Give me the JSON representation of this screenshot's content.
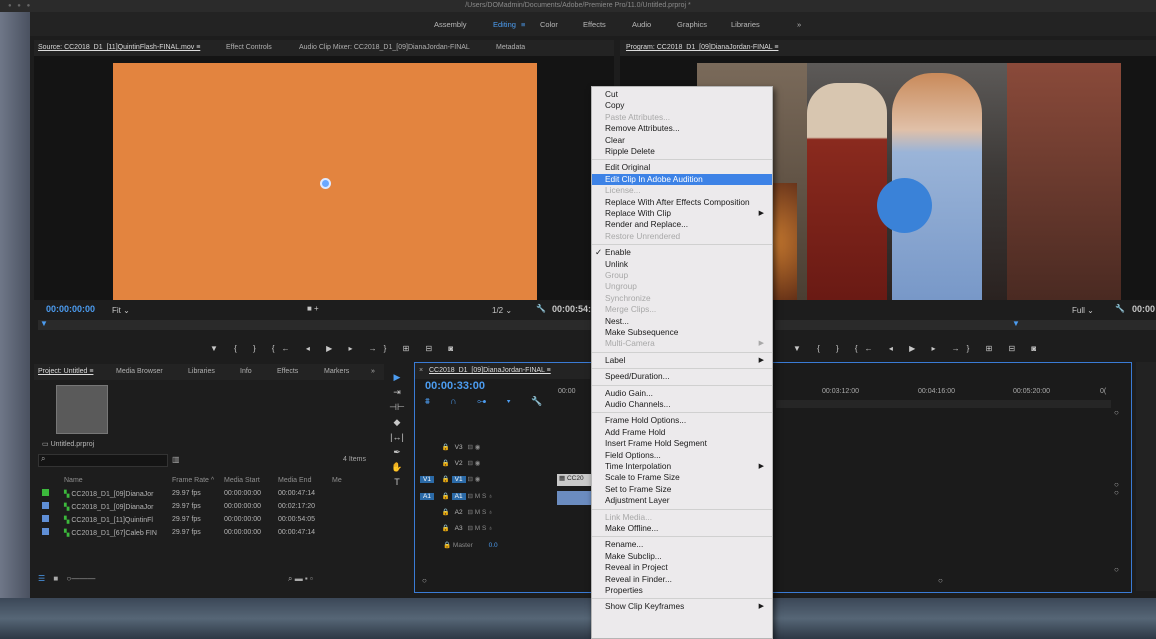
{
  "window": {
    "path": "/Users/DOMadmin/Documents/Adobe/Premiere Pro/11.0/Untitled.prproj *"
  },
  "workspaces": {
    "items": [
      "Assembly",
      "Editing",
      "Color",
      "Effects",
      "Audio",
      "Graphics",
      "Libraries"
    ],
    "active": "Editing",
    "menu_icon": "≡",
    "overflow": "»"
  },
  "source_panel": {
    "tabs": [
      "Source: CC2018_D1_[11]QuintinFlash-FINAL.mov  ≡",
      "Effect Controls",
      "Audio Clip Mixer: CC2018_D1_[09]DianaJordan-FINAL",
      "Metadata"
    ],
    "timecode": "00:00:00:00",
    "fit": "Fit",
    "resolution": "1/2",
    "duration": "00:00:54:",
    "frame_color": "#e3843f"
  },
  "program_panel": {
    "title": "Program: CC2018_D1_[09]DianaJordan-FINAL  ≡",
    "full": "Full",
    "timecode": "00:00"
  },
  "project_panel": {
    "tabs": [
      "Project: Untitled  ≡",
      "Media Browser",
      "Libraries",
      "Info",
      "Effects",
      "Markers",
      "»"
    ],
    "file": "Untitled.prproj",
    "item_count": "4 Items",
    "columns": [
      "Name",
      "Frame Rate ^",
      "Media Start",
      "Media End",
      "Me"
    ],
    "rows": [
      {
        "color": "#3cb93c",
        "name": "CC2018_D1_[09]DianaJor",
        "fps": "29.97 fps",
        "start": "00:00:00:00",
        "end": "00:00:47:14"
      },
      {
        "color": "#5f8fd6",
        "name": "CC2018_D1_[09]DianaJor",
        "fps": "29.97 fps",
        "start": "00:00:00:00",
        "end": "00:02:17:20"
      },
      {
        "color": "#5f8fd6",
        "name": "CC2018_D1_[11]QuintinFl",
        "fps": "29.97 fps",
        "start": "00:00:00:00",
        "end": "00:00:54:05"
      },
      {
        "color": "#5f8fd6",
        "name": "CC2018_D1_[67]Caleb FIN",
        "fps": "29.97 fps",
        "start": "00:00:00:00",
        "end": "00:00:47:14"
      }
    ]
  },
  "timeline": {
    "title": "CC2018_D1_[09]DianaJordan-FINAL  ≡",
    "timecode": "00:00:33:00",
    "ruler": [
      "00:00",
      "00:03:12:00",
      "00:04:16:00",
      "00:05:20:00",
      "0("
    ],
    "tracks": [
      {
        "target": "",
        "name": "V3"
      },
      {
        "target": "",
        "name": "V2"
      },
      {
        "target": "V1",
        "name": "V1"
      },
      {
        "target": "A1",
        "name": "A1"
      },
      {
        "target": "",
        "name": "A2"
      },
      {
        "target": "",
        "name": "A3"
      }
    ],
    "master": "Master",
    "master_level": "0.0",
    "clip_label": "CC20"
  },
  "context_menu": {
    "groups": [
      [
        {
          "label": "Cut"
        },
        {
          "label": "Copy"
        },
        {
          "label": "Paste Attributes...",
          "disabled": true
        },
        {
          "label": "Remove Attributes..."
        },
        {
          "label": "Clear"
        },
        {
          "label": "Ripple Delete"
        }
      ],
      [
        {
          "label": "Edit Original"
        },
        {
          "label": "Edit Clip In Adobe Audition",
          "highlighted": true
        },
        {
          "label": "License...",
          "disabled": true
        },
        {
          "label": "Replace With After Effects Composition"
        },
        {
          "label": "Replace With Clip",
          "submenu": true
        },
        {
          "label": "Render and Replace..."
        },
        {
          "label": "Restore Unrendered",
          "disabled": true
        }
      ],
      [
        {
          "label": "Enable",
          "checked": true
        },
        {
          "label": "Unlink"
        },
        {
          "label": "Group",
          "disabled": true
        },
        {
          "label": "Ungroup",
          "disabled": true
        },
        {
          "label": "Synchronize",
          "disabled": true
        },
        {
          "label": "Merge Clips...",
          "disabled": true
        },
        {
          "label": "Nest..."
        },
        {
          "label": "Make Subsequence"
        },
        {
          "label": "Multi-Camera",
          "disabled": true,
          "submenu": true
        }
      ],
      [
        {
          "label": "Label",
          "submenu": true
        }
      ],
      [
        {
          "label": "Speed/Duration..."
        }
      ],
      [
        {
          "label": "Audio Gain..."
        },
        {
          "label": "Audio Channels..."
        }
      ],
      [
        {
          "label": "Frame Hold Options..."
        },
        {
          "label": "Add Frame Hold"
        },
        {
          "label": "Insert Frame Hold Segment"
        },
        {
          "label": "Field Options..."
        },
        {
          "label": "Time Interpolation",
          "submenu": true
        },
        {
          "label": "Scale to Frame Size"
        },
        {
          "label": "Set to Frame Size"
        },
        {
          "label": "Adjustment Layer"
        }
      ],
      [
        {
          "label": "Link Media...",
          "disabled": true
        },
        {
          "label": "Make Offline..."
        }
      ],
      [
        {
          "label": "Rename..."
        },
        {
          "label": "Make Subclip..."
        },
        {
          "label": "Reveal in Project"
        },
        {
          "label": "Reveal in Finder..."
        },
        {
          "label": "Properties"
        }
      ],
      [
        {
          "label": "Show Clip Keyframes",
          "submenu": true
        }
      ]
    ],
    "check_glyph": "✓",
    "submenu_glyph": "▶"
  },
  "colors": {
    "accent": "#4c9cf0",
    "menu_highlight": "#3d82e6",
    "track_target": "#2b6aa7"
  }
}
